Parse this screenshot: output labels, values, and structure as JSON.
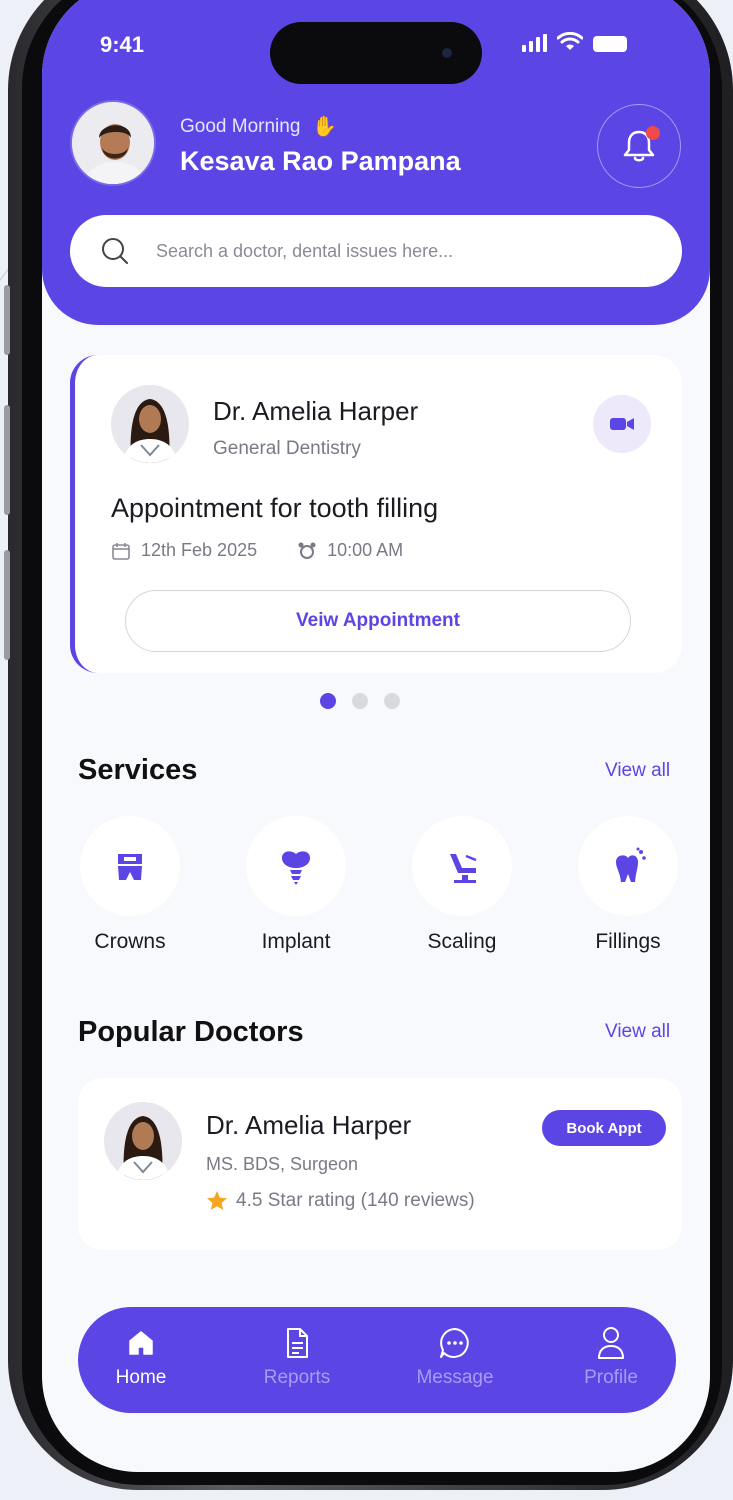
{
  "colors": {
    "primary": "#5b45e4",
    "notification": "#ef4a4a",
    "star": "#f5a623"
  },
  "status_bar": {
    "time": "9:41"
  },
  "header": {
    "greeting": "Good Morning",
    "user_name": "Kesava Rao Pampana",
    "icons": {
      "avatar": "user-avatar",
      "notification": "bell-icon"
    }
  },
  "search": {
    "placeholder": "Search a doctor, dental issues here..."
  },
  "appointment": {
    "doctor_name": "Dr. Amelia Harper",
    "specialty": "General Dentistry",
    "title": "Appointment for tooth filling",
    "date": "12th Feb 2025",
    "time": "10:00 AM",
    "button_label": "Veiw Appointment",
    "carousel": {
      "pages": 3,
      "active": 1
    }
  },
  "services": {
    "title": "Services",
    "view_all": "View all",
    "items": [
      {
        "label": "Crowns",
        "icon": "crown-tooth-icon"
      },
      {
        "label": "Implant",
        "icon": "implant-icon"
      },
      {
        "label": "Scaling",
        "icon": "dental-chair-icon"
      },
      {
        "label": "Fillings",
        "icon": "filling-tooth-icon"
      }
    ]
  },
  "popular_doctors": {
    "title": "Popular Doctors",
    "view_all": "View all",
    "items": [
      {
        "name": "Dr. Amelia Harper",
        "qualification": "MS. BDS, Surgeon",
        "rating_text": "4.5 Star rating (140 reviews)",
        "book_label": "Book Appt"
      }
    ]
  },
  "bottom_nav": {
    "items": [
      {
        "label": "Home",
        "icon": "home-icon",
        "active": true
      },
      {
        "label": "Reports",
        "icon": "document-icon",
        "active": false
      },
      {
        "label": "Message",
        "icon": "chat-icon",
        "active": false
      },
      {
        "label": "Profile",
        "icon": "user-icon",
        "active": false
      }
    ]
  }
}
